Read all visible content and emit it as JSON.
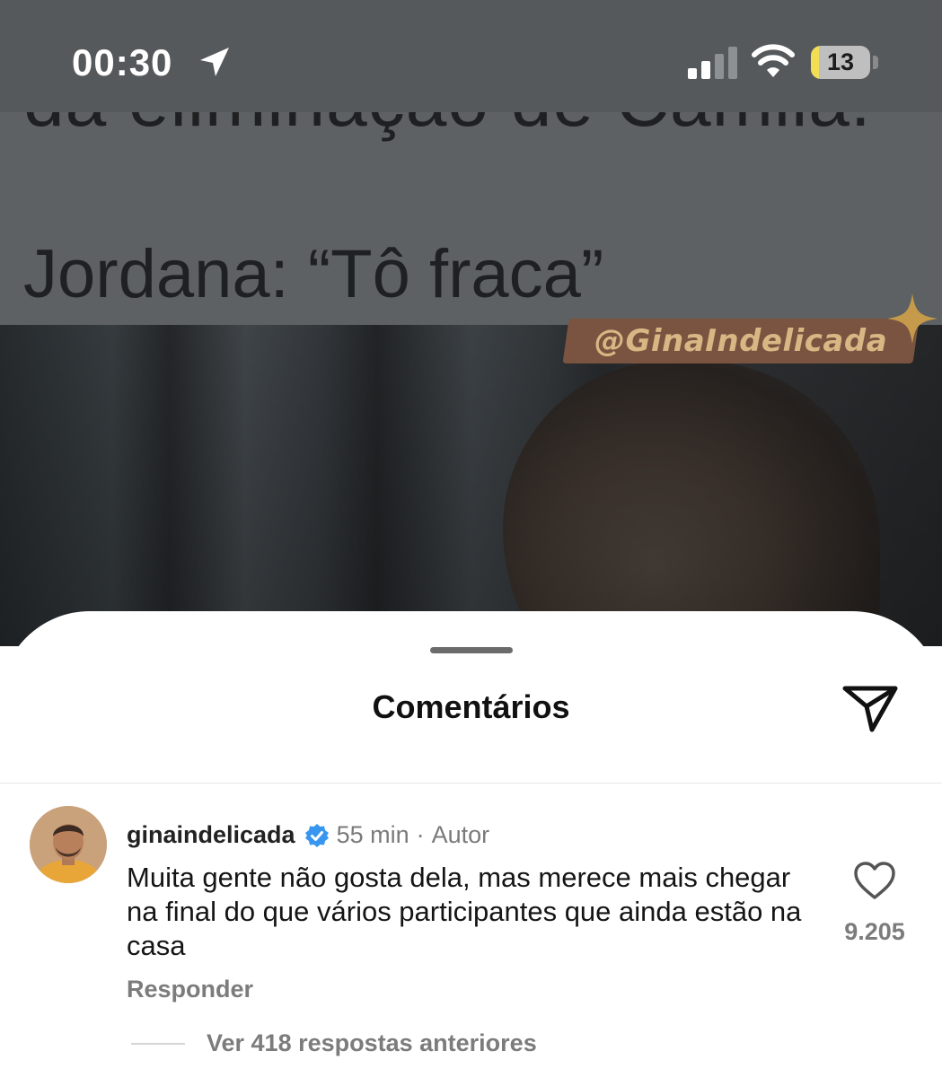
{
  "status_bar": {
    "time": "00:30",
    "battery_level": "13",
    "battery_fraction": 0.13,
    "icons": [
      "location-arrow-icon",
      "cellular-signal-icon",
      "wifi-icon",
      "battery-icon"
    ]
  },
  "post": {
    "partial_text": "da eliminação de Camila.",
    "quote_text": "Jordana: “Tô fraca”",
    "watermark": "@GinaIndelicada"
  },
  "comments_sheet": {
    "title": "Comentários",
    "share_icon": "send-icon",
    "comment": {
      "username": "ginaindelicada",
      "time": "55 min",
      "separator": "·",
      "role": "Autor",
      "verified_icon": "verified-badge-icon",
      "text": "Muita gente não gosta dela, mas merece mais chegar na final do que vários participantes que ainda estão na casa",
      "reply_label": "Responder",
      "like_icon": "heart-icon",
      "like_count": "9.205",
      "view_replies": "Ver 418 respostas anteriores"
    }
  },
  "colors": {
    "verified_blue": "#3797f0",
    "battery_fill": "#f2dd54",
    "watermark_bg": "#7a5440",
    "watermark_text": "#d9b784"
  }
}
